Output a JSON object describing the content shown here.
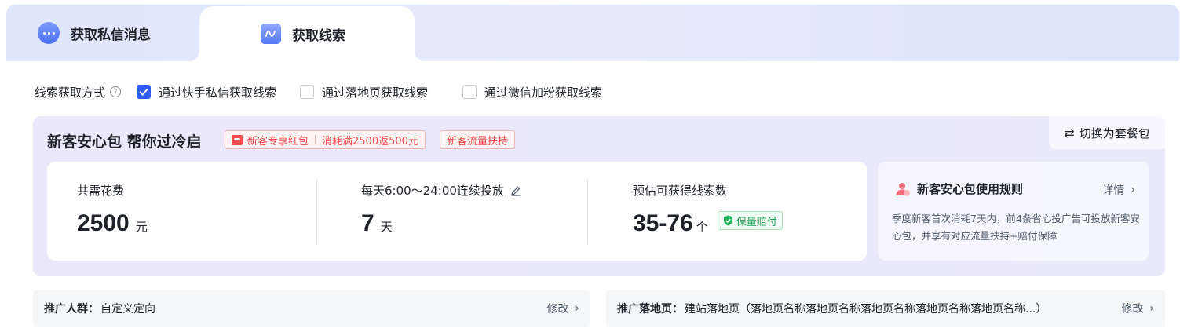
{
  "tabs": [
    {
      "label": "获取私信消息",
      "icon": "chat-bubble-icon",
      "active": false
    },
    {
      "label": "获取线索",
      "icon": "lead-icon",
      "active": true
    }
  ],
  "method": {
    "label": "线索获取方式",
    "options": [
      {
        "label": "通过快手私信获取线索",
        "checked": true
      },
      {
        "label": "通过落地页获取线索",
        "checked": false
      },
      {
        "label": "通过微信加粉获取线索",
        "checked": false
      }
    ]
  },
  "package": {
    "title": "新客安心包 帮你过冷启",
    "tag1_part1": "新客专享红包",
    "tag1_part2": "消耗满2500返500元",
    "tag2": "新客流量扶持",
    "switch_label": "切换为套餐包",
    "stats": [
      {
        "label": "共需花费",
        "value": "2500",
        "unit": "元"
      },
      {
        "label": "每天6:00～24:00连续投放",
        "value": "7",
        "unit": "天"
      },
      {
        "label": "预估可获得线索数",
        "value": "35-76",
        "unit": "个",
        "badge": "保量赔付"
      }
    ],
    "rules": {
      "title": "新客安心包使用规则",
      "detail": "详情",
      "desc": "季度新客首次消耗7天内，前4条省心投广告可投放新客安心包，并享有对应流量扶持+赔付保障"
    }
  },
  "targeting": {
    "label": "推广人群：",
    "value": "自定义定向",
    "action": "修改"
  },
  "landing": {
    "label": "推广落地页：",
    "value": "建站落地页（落地页名称落地页名称落地页名称落地页名称落地页名称...）",
    "action": "修改"
  },
  "colors": {
    "accent": "#2f5cf5",
    "tag_red": "#f24a4f",
    "badge_green": "#1f9d55"
  }
}
